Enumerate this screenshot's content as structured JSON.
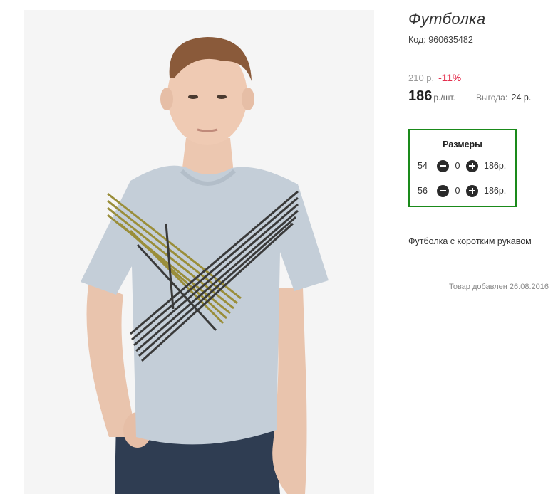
{
  "product": {
    "title": "Футболка",
    "code": "Код: 960635482",
    "old_price": "210 р.",
    "discount": "-11%",
    "price": "186",
    "price_unit": "р./шт.",
    "benefit_label": "Выгода:",
    "benefit_value": "24 р.",
    "description": "Футболка с коротким рукавом",
    "added": "Товар добавлен 26.08.2016"
  },
  "sizes": {
    "title": "Размеры",
    "rows": [
      {
        "size": "54",
        "qty": "0",
        "price": "186р."
      },
      {
        "size": "56",
        "qty": "0",
        "price": "186р."
      }
    ]
  },
  "icons": {
    "minus": "minus-circle-icon",
    "plus": "plus-circle-icon"
  },
  "colors": {
    "discount": "#e4304f",
    "sizes_border": "#1a8a1a"
  }
}
